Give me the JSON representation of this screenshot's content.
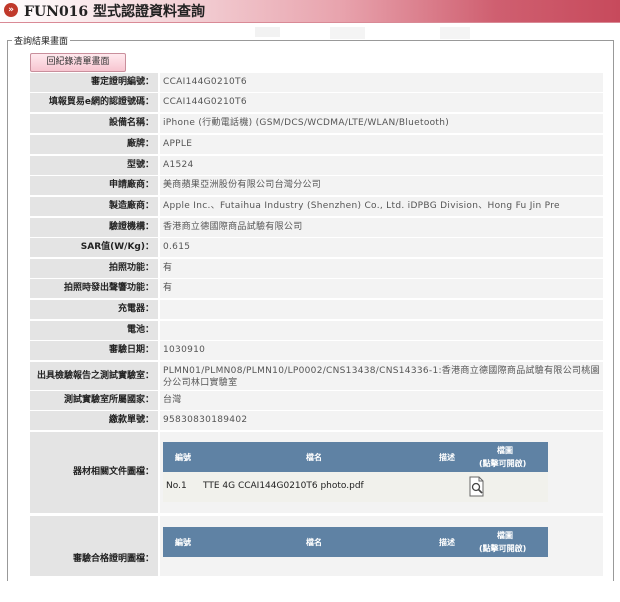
{
  "page": {
    "title": "FUN016 型式認證資料查詢",
    "section_legend": "查詢結果畫面",
    "back_button": "回紀錄清單畫面"
  },
  "fields": [
    {
      "label": "審定證明編號：",
      "value": "CCAI144G0210T6"
    },
    {
      "label": "填報貿易e網的認證號碼：",
      "value": "CCAI144G0210T6"
    },
    {
      "label": "設備名稱：",
      "value": "iPhone (行動電話機) (GSM/DCS/WCDMA/LTE/WLAN/Bluetooth)"
    },
    {
      "label": "廠牌：",
      "value": "APPLE"
    },
    {
      "label": "型號：",
      "value": "A1524"
    },
    {
      "label": "申請廠商：",
      "value": "美商蘋果亞洲股份有限公司台灣分公司"
    },
    {
      "label": "製造廠商：",
      "value": "Apple Inc.、Futaihua Industry (Shenzhen) Co., Ltd. iDPBG Division、Hong Fu Jin Pre"
    },
    {
      "label": "驗證機構：",
      "value": "香港商立德國際商品試驗有限公司"
    },
    {
      "label": "SAR值(W/Kg)：",
      "value": "0.615"
    },
    {
      "label": "拍照功能：",
      "value": "有"
    },
    {
      "label": "拍照時發出聲響功能：",
      "value": "有"
    },
    {
      "label": "充電器：",
      "value": ""
    },
    {
      "label": "電池：",
      "value": ""
    },
    {
      "label": "審驗日期：",
      "value": "1030910"
    },
    {
      "label": "出具檢驗報告之測試實驗室：",
      "value": "PLMN01/PLMN08/PLMN10/LP0002/CNS13438/CNS14336-1:香港商立德國際商品試驗有限公司桃園分公司林口實驗室"
    },
    {
      "label": "測試實驗室所屬國家：",
      "value": "台灣"
    },
    {
      "label": "繳款單號：",
      "value": "95830830189402"
    }
  ],
  "equipment_docs": {
    "label": "器材相關文件圖檔：",
    "headers": {
      "no": "編號",
      "name": "檔名",
      "desc": "描述",
      "file": "檔圖",
      "file_hint": "(點擊可開啟)"
    },
    "rows": [
      {
        "no": "No.1",
        "name": "TTE 4G CCAI144G0210T6 photo.pdf",
        "desc": "",
        "icon": "magnifier-document-icon"
      }
    ]
  },
  "approval_docs": {
    "label": "審驗合格證明圖檔：",
    "headers": {
      "no": "編號",
      "name": "檔名",
      "desc": "描述",
      "file": "檔圖",
      "file_hint": "(點擊可開啟)"
    }
  },
  "colors": {
    "header_accent": "#c74a5c",
    "table_header": "#5f82a4",
    "label_bg": "#e4e4e4",
    "value_bg": "#f3f3f3"
  }
}
